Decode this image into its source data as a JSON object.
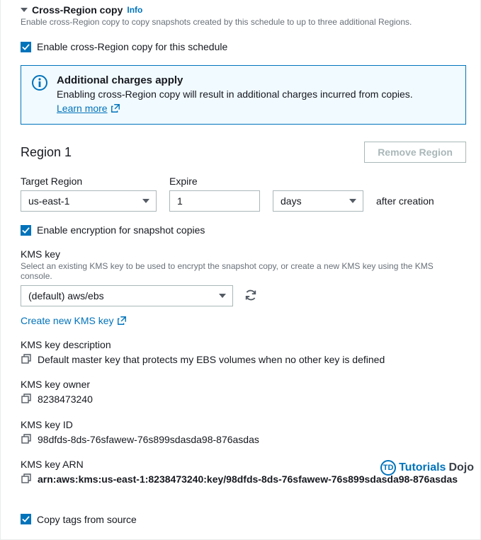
{
  "section": {
    "title": "Cross-Region copy",
    "info_label": "Info",
    "description": "Enable cross-Region copy to copy snapshots created by this schedule to up to three additional Regions."
  },
  "enable_crc": {
    "label": "Enable cross-Region copy for this schedule",
    "checked": true
  },
  "alert": {
    "title": "Additional charges apply",
    "text": "Enabling cross-Region copy will result in additional charges incurred from copies. ",
    "link_label": "Learn more"
  },
  "region": {
    "title": "Region 1",
    "remove_label": "Remove Region",
    "target_label": "Target Region",
    "target_value": "us-east-1",
    "expire_label": "Expire",
    "expire_value": "1",
    "unit_value": "days",
    "after_label": "after creation"
  },
  "enable_encrypt": {
    "label": "Enable encryption for snapshot copies",
    "checked": true
  },
  "kms": {
    "label": "KMS key",
    "desc": "Select an existing KMS key to be used to encrypt the snapshot copy, or create a new KMS key using the KMS console.",
    "value": "(default) aws/ebs",
    "create_link": "Create new KMS key",
    "desc_label": "KMS key description",
    "desc_value": "Default master key that protects my EBS volumes when no other key is defined",
    "owner_label": "KMS key owner",
    "owner_value": "8238473240",
    "id_label": "KMS key ID",
    "id_value": "98dfds-8ds-76sfawew-76s899sdasda98-876asdas",
    "arn_label": "KMS key ARN",
    "arn_value": "arn:aws:kms:us-east-1:8238473240:key/98dfds-8ds-76sfawew-76s899sdasda98-876asdas"
  },
  "copy_tags": {
    "label": "Copy tags from source",
    "checked": true
  },
  "watermark": {
    "brand1": "Tutorials",
    "brand2": "Dojo",
    "badge": "TD"
  }
}
